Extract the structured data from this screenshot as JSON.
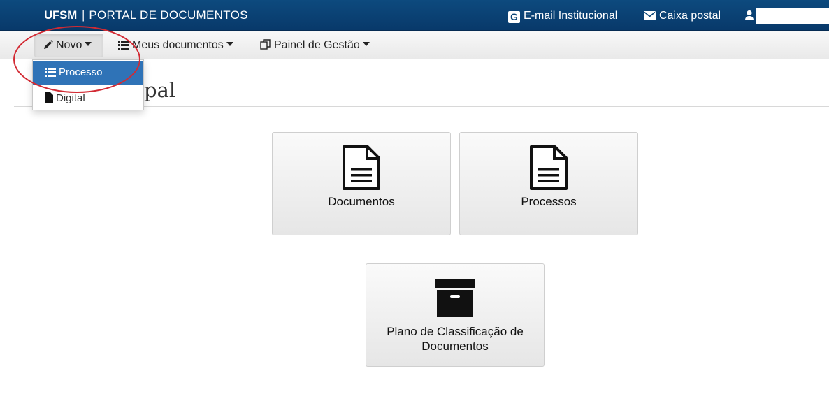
{
  "header": {
    "brand_strong": "UFSM",
    "brand_separator": "|",
    "brand_title": "PORTAL DE DOCUMENTOS",
    "email_label": "E-mail Institucional",
    "mail_label": "Caixa postal",
    "user_name": ""
  },
  "nav": {
    "novo_label": "Novo",
    "meus_documentos_label": "Meus documentos",
    "painel_label": "Painel de Gestão"
  },
  "dropdown": {
    "items": [
      {
        "label": "Processo",
        "icon": "list-icon",
        "active": true
      },
      {
        "label": "Digital",
        "icon": "file-icon",
        "active": false
      }
    ]
  },
  "page": {
    "heading_visible_fragment": "pal"
  },
  "tiles": [
    {
      "label": "Documentos",
      "icon": "document-icon"
    },
    {
      "label": "Processos",
      "icon": "document-icon"
    },
    {
      "label": "Plano de Classificação de Documentos",
      "icon": "archive-box-icon"
    }
  ],
  "colors": {
    "header_bg": "#0b4677",
    "active_item": "#2f73b7",
    "annotation": "#d22a33"
  }
}
